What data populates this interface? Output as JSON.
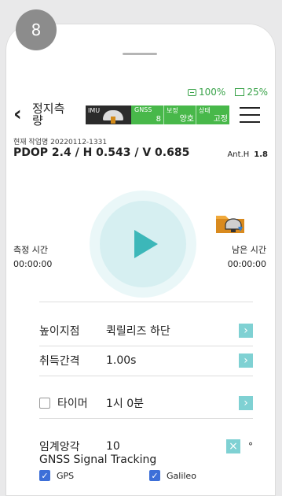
{
  "step_badge": "8",
  "status": {
    "battery": "100%",
    "tablet": "25%"
  },
  "header": {
    "title": "정지측\n량",
    "imu_label": "IMU",
    "gnss": {
      "gnss_label": "GNSS",
      "gnss_value": "8",
      "correction_label": "보정",
      "correction_value": "양호",
      "state_label": "상태",
      "state_value": "고정"
    }
  },
  "job": {
    "label_line": "현재 작업명 20220112-1331"
  },
  "pdop": {
    "text": "PDOP 2.4 / H 0.543 / V 0.685",
    "anth_label": "Ant.H",
    "anth_value": "1.8"
  },
  "timers": {
    "measure_label": "측정 시간",
    "measure_value": "00:00:00",
    "remain_label": "남은 시간",
    "remain_value": "00:00:00"
  },
  "settings": {
    "height_label": "높이지점",
    "height_value": "퀵릴리즈 하단",
    "interval_label": "취득간격",
    "interval_value": "1.00s",
    "timer_label": "타이머",
    "timer_value": "1시 0분",
    "mask_label": "임계앙각",
    "mask_value": "10",
    "mask_unit": "°"
  },
  "gnss_tracking": {
    "title": "GNSS Signal Tracking",
    "items": [
      {
        "label": "GPS",
        "checked": true
      },
      {
        "label": "Galileo",
        "checked": true
      }
    ]
  },
  "colors": {
    "status_green": "#3aa34a",
    "gnss_green": "#48b84a",
    "accent_teal": "#3cb7b9",
    "check_blue": "#3d6fd8"
  }
}
